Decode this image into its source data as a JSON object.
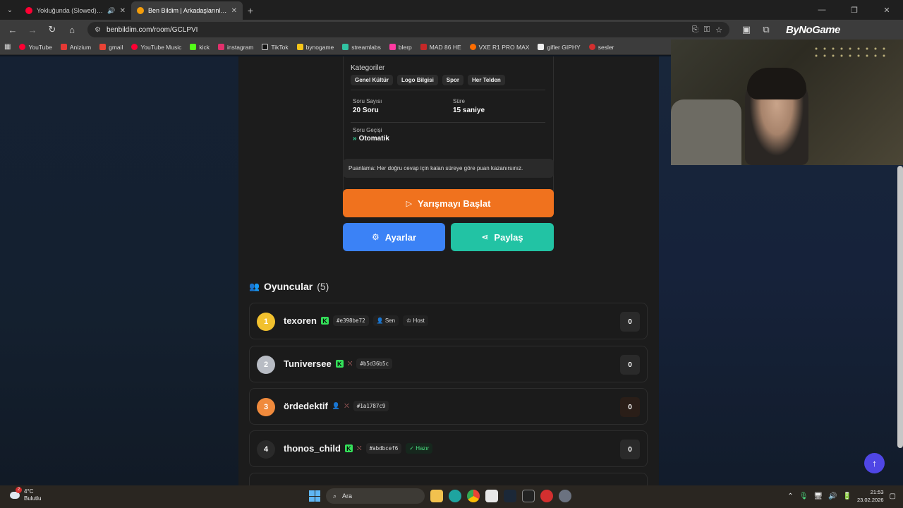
{
  "browser": {
    "tabs": [
      {
        "title": "Yokluğunda (Slowed) | YouTube",
        "favicon_color": "#ff0033",
        "active": false
      },
      {
        "title": "Ben Bildim | Arkadaşlarınla Online",
        "favicon_color": "#f59e0b",
        "active": true
      }
    ],
    "url": "benbildim.com/room/GCLPVI",
    "brand": "ByNoGame",
    "bookmarks": [
      {
        "label": "YouTube",
        "color": "#ff0033"
      },
      {
        "label": "Anizium",
        "color": "#e53935"
      },
      {
        "label": "gmail",
        "color": "#ea4335"
      },
      {
        "label": "YouTube Music",
        "color": "#ff0033"
      },
      {
        "label": "kick",
        "color": "#53fc18"
      },
      {
        "label": "instagram",
        "color": "#e1306c"
      },
      {
        "label": "TikTok",
        "color": "#ffffff"
      },
      {
        "label": "bynogame",
        "color": "#f5c518"
      },
      {
        "label": "streamlabs",
        "color": "#31c3a2"
      },
      {
        "label": "blerp",
        "color": "#ff3aa1"
      },
      {
        "label": "MAD 86 HE",
        "color": "#c62828"
      },
      {
        "label": "VXE R1 PRO MAX",
        "color": "#ff6d00"
      },
      {
        "label": "gifler GIPHY",
        "color": "#ffffff"
      },
      {
        "label": "sesler",
        "color": "#d32f2f"
      }
    ]
  },
  "room": {
    "categories_title": "Kategoriler",
    "categories": [
      "Genel Kültür",
      "Logo Bilgisi",
      "Spor",
      "Her Telden"
    ],
    "question_count_label": "Soru Sayısı",
    "question_count": "20 Soru",
    "duration_label": "Süre",
    "duration": "15 saniye",
    "transition_label": "Soru Geçişi",
    "transition": "Otomatik",
    "scoring_note": "Puanlama: Her doğru cevap için kalan süreye göre puan kazanırsınız.",
    "start_button": "Yarışmayı Başlat",
    "settings_button": "Ayarlar",
    "share_button": "Paylaş"
  },
  "players": {
    "title": "Oyuncular",
    "count": "(5)",
    "rows": [
      {
        "rank": "1",
        "name": "texoren",
        "tag": "#e398be72",
        "badges": [
          "Sen",
          "Host"
        ],
        "score": "0",
        "rank_color": "#f2c12e"
      },
      {
        "rank": "2",
        "name": "Tuniversee",
        "tag": "#b5d36b5c",
        "badges": [],
        "score": "0",
        "rank_color": "#b8bcc4"
      },
      {
        "rank": "3",
        "name": "ördedektif",
        "tag": "#1a1787c9",
        "badges": [],
        "score": "0",
        "rank_color": "#f08a3c"
      },
      {
        "rank": "4",
        "name": "thonos_child",
        "tag": "#abdbcef6",
        "badges": [
          "Hazır"
        ],
        "score": "0",
        "rank_color": "#2a2a2a"
      }
    ]
  },
  "taskbar": {
    "temperature": "4°C",
    "weather": "Bulutlu",
    "search_placeholder": "Ara",
    "time": "21:53",
    "date": "23.02.2026",
    "weather_badge": "2"
  }
}
